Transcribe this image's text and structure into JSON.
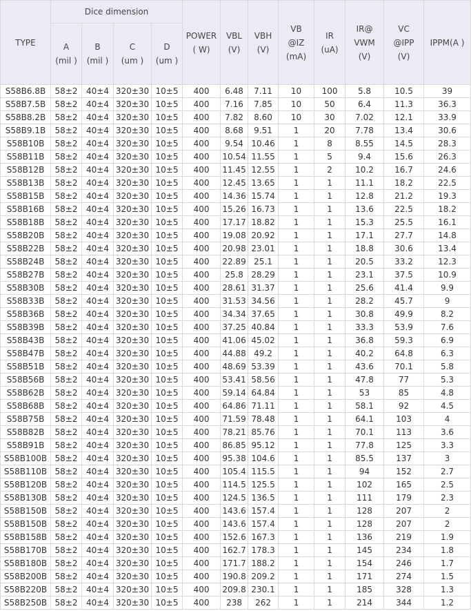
{
  "headers": {
    "type": "TYPE",
    "dice": "Dice dimension",
    "a": [
      "A",
      "(mil )"
    ],
    "b": [
      "B",
      "(mil )"
    ],
    "c": [
      "C",
      "(um )"
    ],
    "d": [
      "D",
      "(um )"
    ],
    "power": [
      "POWER",
      "( W)"
    ],
    "vbl": [
      "VBL",
      "(V)"
    ],
    "vbh": [
      "VBH",
      "(V)"
    ],
    "vb": [
      "VB",
      "@IZ",
      "(mA)"
    ],
    "ir": [
      "IR",
      "(uA)"
    ],
    "irvwm": [
      "IR@",
      "VWM",
      "(V)"
    ],
    "vc": [
      "VC",
      "@IPP",
      "(V)"
    ],
    "ippm": [
      "IPPM(A )"
    ]
  },
  "rows": [
    [
      "S58B6.8B",
      "58±2",
      "40±4",
      "320±30",
      "10±5",
      "400",
      "6.48",
      "7.11",
      "10",
      "100",
      "5.8",
      "10.5",
      "39"
    ],
    [
      "S58B7.5B",
      "58±2",
      "40±4",
      "320±30",
      "10±5",
      "400",
      "7.16",
      "7.85",
      "10",
      "50",
      "6.4",
      "11.3",
      "36.3"
    ],
    [
      "S58B8.2B",
      "58±2",
      "40±4",
      "320±30",
      "10±5",
      "400",
      "7.82",
      "8.60",
      "10",
      "30",
      "7.02",
      "12.1",
      "33.9"
    ],
    [
      "S58B9.1B",
      "58±2",
      "40±4",
      "320±30",
      "10±5",
      "400",
      "8.68",
      "9.51",
      "1",
      "20",
      "7.78",
      "13.4",
      "30.6"
    ],
    [
      "S58B10B",
      "58±2",
      "40±4",
      "320±30",
      "10±5",
      "400",
      "9.54",
      "10.46",
      "1",
      "8",
      "8.55",
      "14.5",
      "28.3"
    ],
    [
      "S58B11B",
      "58±2",
      "40±4",
      "320±30",
      "10±5",
      "400",
      "10.54",
      "11.55",
      "1",
      "5",
      "9.4",
      "15.6",
      "26.3"
    ],
    [
      "S58B12B",
      "58±2",
      "40±4",
      "320±30",
      "10±5",
      "400",
      "11.45",
      "12.55",
      "1",
      "2",
      "10.2",
      "16.7",
      "24.6"
    ],
    [
      "S58B13B",
      "58±2",
      "40±4",
      "320±30",
      "10±5",
      "400",
      "12.45",
      "13.65",
      "1",
      "1",
      "11.1",
      "18.2",
      "22.5"
    ],
    [
      "S58B15B",
      "58±2",
      "40±4",
      "320±30",
      "10±5",
      "400",
      "14.36",
      "15.74",
      "1",
      "1",
      "12.8",
      "21.2",
      "19.3"
    ],
    [
      "S58B16B",
      "58±2",
      "40±4",
      "320±30",
      "10±5",
      "400",
      "15.26",
      "16.73",
      "1",
      "1",
      "13.6",
      "22.5",
      "18.2"
    ],
    [
      "S58B18B",
      "58±2",
      "40±4",
      "320±30",
      "10±5",
      "400",
      "17.17",
      "18.82",
      "1",
      "1",
      "15.3",
      "25.5",
      "16.1"
    ],
    [
      "S58B20B",
      "58±2",
      "40±4",
      "320±30",
      "10±5",
      "400",
      "19.08",
      "20.92",
      "1",
      "1",
      "17.1",
      "27.7",
      "14.8"
    ],
    [
      "S58B22B",
      "58±2",
      "40±4",
      "320±30",
      "10±5",
      "400",
      "20.98",
      "23.01",
      "1",
      "1",
      "18.8",
      "30.6",
      "13.4"
    ],
    [
      "S58B24B",
      "58±2",
      "40±4",
      "320±30",
      "10±5",
      "400",
      "22.89",
      "25.1",
      "1",
      "1",
      "20.5",
      "33.2",
      "12.3"
    ],
    [
      "S58B27B",
      "58±2",
      "40±4",
      "320±30",
      "10±5",
      "400",
      "25.8",
      "28.29",
      "1",
      "1",
      "23.1",
      "37.5",
      "10.9"
    ],
    [
      "S58B30B",
      "58±2",
      "40±4",
      "320±30",
      "10±5",
      "400",
      "28.61",
      "31.37",
      "1",
      "1",
      "25.6",
      "41.4",
      "9.9"
    ],
    [
      "S58B33B",
      "58±2",
      "40±4",
      "320±30",
      "10±5",
      "400",
      "31.53",
      "34.56",
      "1",
      "1",
      "28.2",
      "45.7",
      "9"
    ],
    [
      "S58B36B",
      "58±2",
      "40±4",
      "320±30",
      "10±5",
      "400",
      "34.34",
      "37.65",
      "1",
      "1",
      "30.8",
      "49.9",
      "8.2"
    ],
    [
      "S58B39B",
      "58±2",
      "40±4",
      "320±30",
      "10±5",
      "400",
      "37.25",
      "40.84",
      "1",
      "1",
      "33.3",
      "53.9",
      "7.6"
    ],
    [
      "S58B43B",
      "58±2",
      "40±4",
      "320±30",
      "10±5",
      "400",
      "41.06",
      "45.02",
      "1",
      "1",
      "36.8",
      "59.3",
      "6.9"
    ],
    [
      "S58B47B",
      "58±2",
      "40±4",
      "320±30",
      "10±5",
      "400",
      "44.88",
      "49.2",
      "1",
      "1",
      "40.2",
      "64.8",
      "6.3"
    ],
    [
      "S58B51B",
      "58±2",
      "40±4",
      "320±30",
      "10±5",
      "400",
      "48.69",
      "53.39",
      "1",
      "1",
      "43.6",
      "70.1",
      "5.8"
    ],
    [
      "S58B56B",
      "58±2",
      "40±4",
      "320±30",
      "10±5",
      "400",
      "53.41",
      "58.56",
      "1",
      "1",
      "47.8",
      "77",
      "5.3"
    ],
    [
      "S58B62B",
      "58±2",
      "40±4",
      "320±30",
      "10±5",
      "400",
      "59.14",
      "64.84",
      "1",
      "1",
      "53",
      "85",
      "4.8"
    ],
    [
      "S58B68B",
      "58±2",
      "40±4",
      "320±30",
      "10±5",
      "400",
      "64.86",
      "71.11",
      "1",
      "1",
      "58.1",
      "92",
      "4.5"
    ],
    [
      "S58B75B",
      "58±2",
      "40±4",
      "320±30",
      "10±5",
      "400",
      "71.59",
      "78.48",
      "1",
      "1",
      "64.1",
      "103",
      "4"
    ],
    [
      "S58B82B",
      "58±2",
      "40±4",
      "320±30",
      "10±5",
      "400",
      "78.21",
      "85.76",
      "1",
      "1",
      "70.1",
      "113",
      "3.6"
    ],
    [
      "S58B91B",
      "58±2",
      "40±4",
      "320±30",
      "10±5",
      "400",
      "86.85",
      "95.12",
      "1",
      "1",
      "77.8",
      "125",
      "3.3"
    ],
    [
      "S58B100B",
      "58±2",
      "40±4",
      "320±30",
      "10±5",
      "400",
      "95.38",
      "104.6",
      "1",
      "1",
      "85.5",
      "137",
      "3"
    ],
    [
      "S58B110B",
      "58±2",
      "40±4",
      "320±30",
      "10±5",
      "400",
      "105.4",
      "115.5",
      "1",
      "1",
      "94",
      "152",
      "2.7"
    ],
    [
      "S58B120B",
      "58±2",
      "40±4",
      "320±30",
      "10±5",
      "400",
      "114.5",
      "125.5",
      "1",
      "1",
      "102",
      "165",
      "2.5"
    ],
    [
      "S58B130B",
      "58±2",
      "40±4",
      "320±30",
      "10±5",
      "400",
      "124.5",
      "136.5",
      "1",
      "1",
      "111",
      "179",
      "2.3"
    ],
    [
      "S58B150B",
      "58±2",
      "40±4",
      "320±30",
      "10±5",
      "400",
      "143.6",
      "157.4",
      "1",
      "1",
      "128",
      "207",
      "2"
    ],
    [
      "S58B150B",
      "58±2",
      "40±4",
      "320±30",
      "10±5",
      "400",
      "143.6",
      "157.4",
      "1",
      "1",
      "128",
      "207",
      "2"
    ],
    [
      "S58B158B",
      "58±2",
      "40±4",
      "320±30",
      "10±5",
      "400",
      "152.6",
      "167.3",
      "1",
      "1",
      "136",
      "219",
      "1.9"
    ],
    [
      "S58B170B",
      "58±2",
      "40±4",
      "320±30",
      "10±5",
      "400",
      "162.7",
      "178.3",
      "1",
      "1",
      "145",
      "234",
      "1.8"
    ],
    [
      "S58B180B",
      "58±2",
      "40±4",
      "320±30",
      "10±5",
      "400",
      "171.7",
      "188.2",
      "1",
      "1",
      "154",
      "246",
      "1.7"
    ],
    [
      "S58B200B",
      "58±2",
      "40±4",
      "320±30",
      "10±5",
      "400",
      "190.8",
      "209.2",
      "1",
      "1",
      "171",
      "274",
      "1.5"
    ],
    [
      "S58B220B",
      "58±2",
      "40±4",
      "320±30",
      "10±5",
      "400",
      "209.8",
      "230.1",
      "1",
      "1",
      "185",
      "328",
      "1.3"
    ],
    [
      "S58B250B",
      "58±2",
      "40±4",
      "320±30",
      "10±5",
      "400",
      "238",
      "262",
      "1",
      "1",
      "214",
      "344",
      "1.2"
    ]
  ]
}
